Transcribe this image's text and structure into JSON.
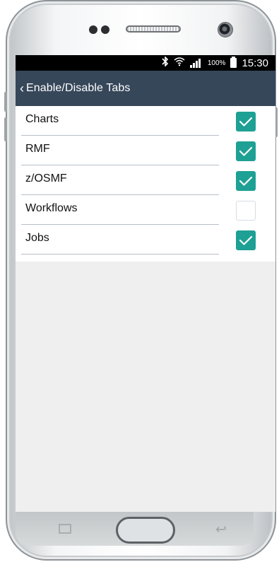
{
  "status_bar": {
    "battery_percent": "100%",
    "time": "15:30",
    "icons": [
      "bluetooth-icon",
      "wifi-icon",
      "signal-icon",
      "battery-icon"
    ]
  },
  "app_bar": {
    "back_glyph": "‹",
    "title": "Enable/Disable Tabs",
    "background": "#37475a"
  },
  "tabs": [
    {
      "label": "Charts",
      "checked": true
    },
    {
      "label": "RMF",
      "checked": true
    },
    {
      "label": "z/OSMF",
      "checked": true
    },
    {
      "label": "Workflows",
      "checked": false
    },
    {
      "label": "Jobs",
      "checked": true
    }
  ],
  "colors": {
    "checkbox_checked": "#1ea094",
    "divider": "#b6bfc6",
    "screen_background": "#efefef"
  },
  "device": {
    "nav_icons": [
      "recent-apps-icon",
      "home-button",
      "back-icon"
    ]
  }
}
